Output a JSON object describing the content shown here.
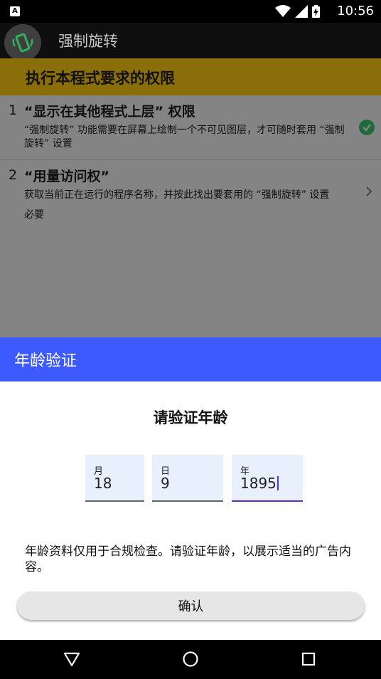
{
  "status_bar": {
    "time": "10:56",
    "left_icon_letter": "A",
    "icons": [
      "wifi-icon",
      "signal-icon",
      "battery-charging-icon"
    ]
  },
  "app_bar": {
    "title": "强制旋转",
    "icon": "rotate-phone-icon"
  },
  "permissions": {
    "header": "执行本程式要求的权限",
    "items": [
      {
        "number": "1",
        "title": "“显示在其他程式上层” 权限",
        "description": "“强制旋转” 功能需要在屏幕上绘制一个不可见图层，才可随时套用 “强制旋转” 设置",
        "status": "",
        "icon": "check-circle-icon"
      },
      {
        "number": "2",
        "title": "“用量访问权”",
        "description": "获取当前正在运行的程序名称，并按此找出要套用的 “强制旋转” 设置",
        "status": "必要",
        "icon": "chevron-right-icon"
      }
    ]
  },
  "dialog": {
    "title": "年龄验证",
    "prompt": "请验证年龄",
    "fields": {
      "month": {
        "label": "月",
        "value": "18"
      },
      "day": {
        "label": "日",
        "value": "9"
      },
      "year": {
        "label": "年",
        "value": "1895"
      }
    },
    "disclaimer": "年龄资料仅用于合规检查。请验证年龄，以展示适当的广告内容。",
    "confirm_label": "确认"
  },
  "colors": {
    "dialog_header": "#3d5afe",
    "permission_header": "#8a6e0a",
    "focus_underline": "#5b2ecf"
  }
}
